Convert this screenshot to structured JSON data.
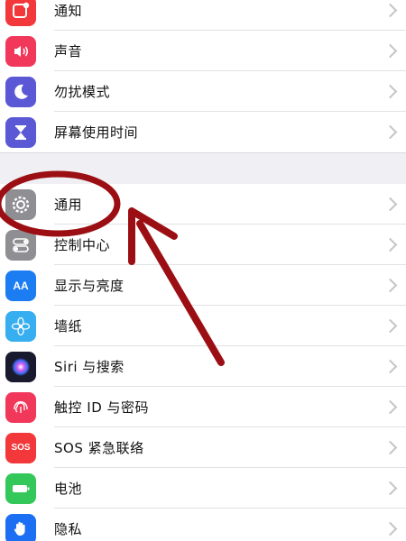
{
  "settings_group_1": {
    "items": [
      {
        "label": "通知",
        "icon": "notifications-icon",
        "color": "#f2383a"
      },
      {
        "label": "声音",
        "icon": "sound-icon",
        "color": "#f2385a"
      },
      {
        "label": "勿扰模式",
        "icon": "moon-icon",
        "color": "#5b58d6"
      },
      {
        "label": "屏幕使用时间",
        "icon": "hourglass-icon",
        "color": "#5b58d6"
      }
    ]
  },
  "settings_group_2": {
    "items": [
      {
        "label": "通用",
        "icon": "gear-icon",
        "color": "#8e8e93"
      },
      {
        "label": "控制中心",
        "icon": "toggles-icon",
        "color": "#8e8e93"
      },
      {
        "label": "显示与亮度",
        "icon": "text-size-icon",
        "color": "#1c7cf2"
      },
      {
        "label": "墙纸",
        "icon": "flower-icon",
        "color": "#37aef0"
      },
      {
        "label": "Siri 与搜索",
        "icon": "siri-icon",
        "color": "#1a1a2e"
      },
      {
        "label": "触控 ID 与密码",
        "icon": "fingerprint-icon",
        "color": "#f2385a"
      },
      {
        "label": "SOS 紧急联络",
        "icon": "sos-icon",
        "color": "#f2383a"
      },
      {
        "label": "电池",
        "icon": "battery-icon",
        "color": "#34c759"
      },
      {
        "label": "隐私",
        "icon": "hand-icon",
        "color": "#1c6ef2"
      }
    ]
  },
  "icon_text": {
    "display": "AA",
    "sos": "SOS"
  },
  "annotation": {
    "color": "#9b0f14"
  }
}
